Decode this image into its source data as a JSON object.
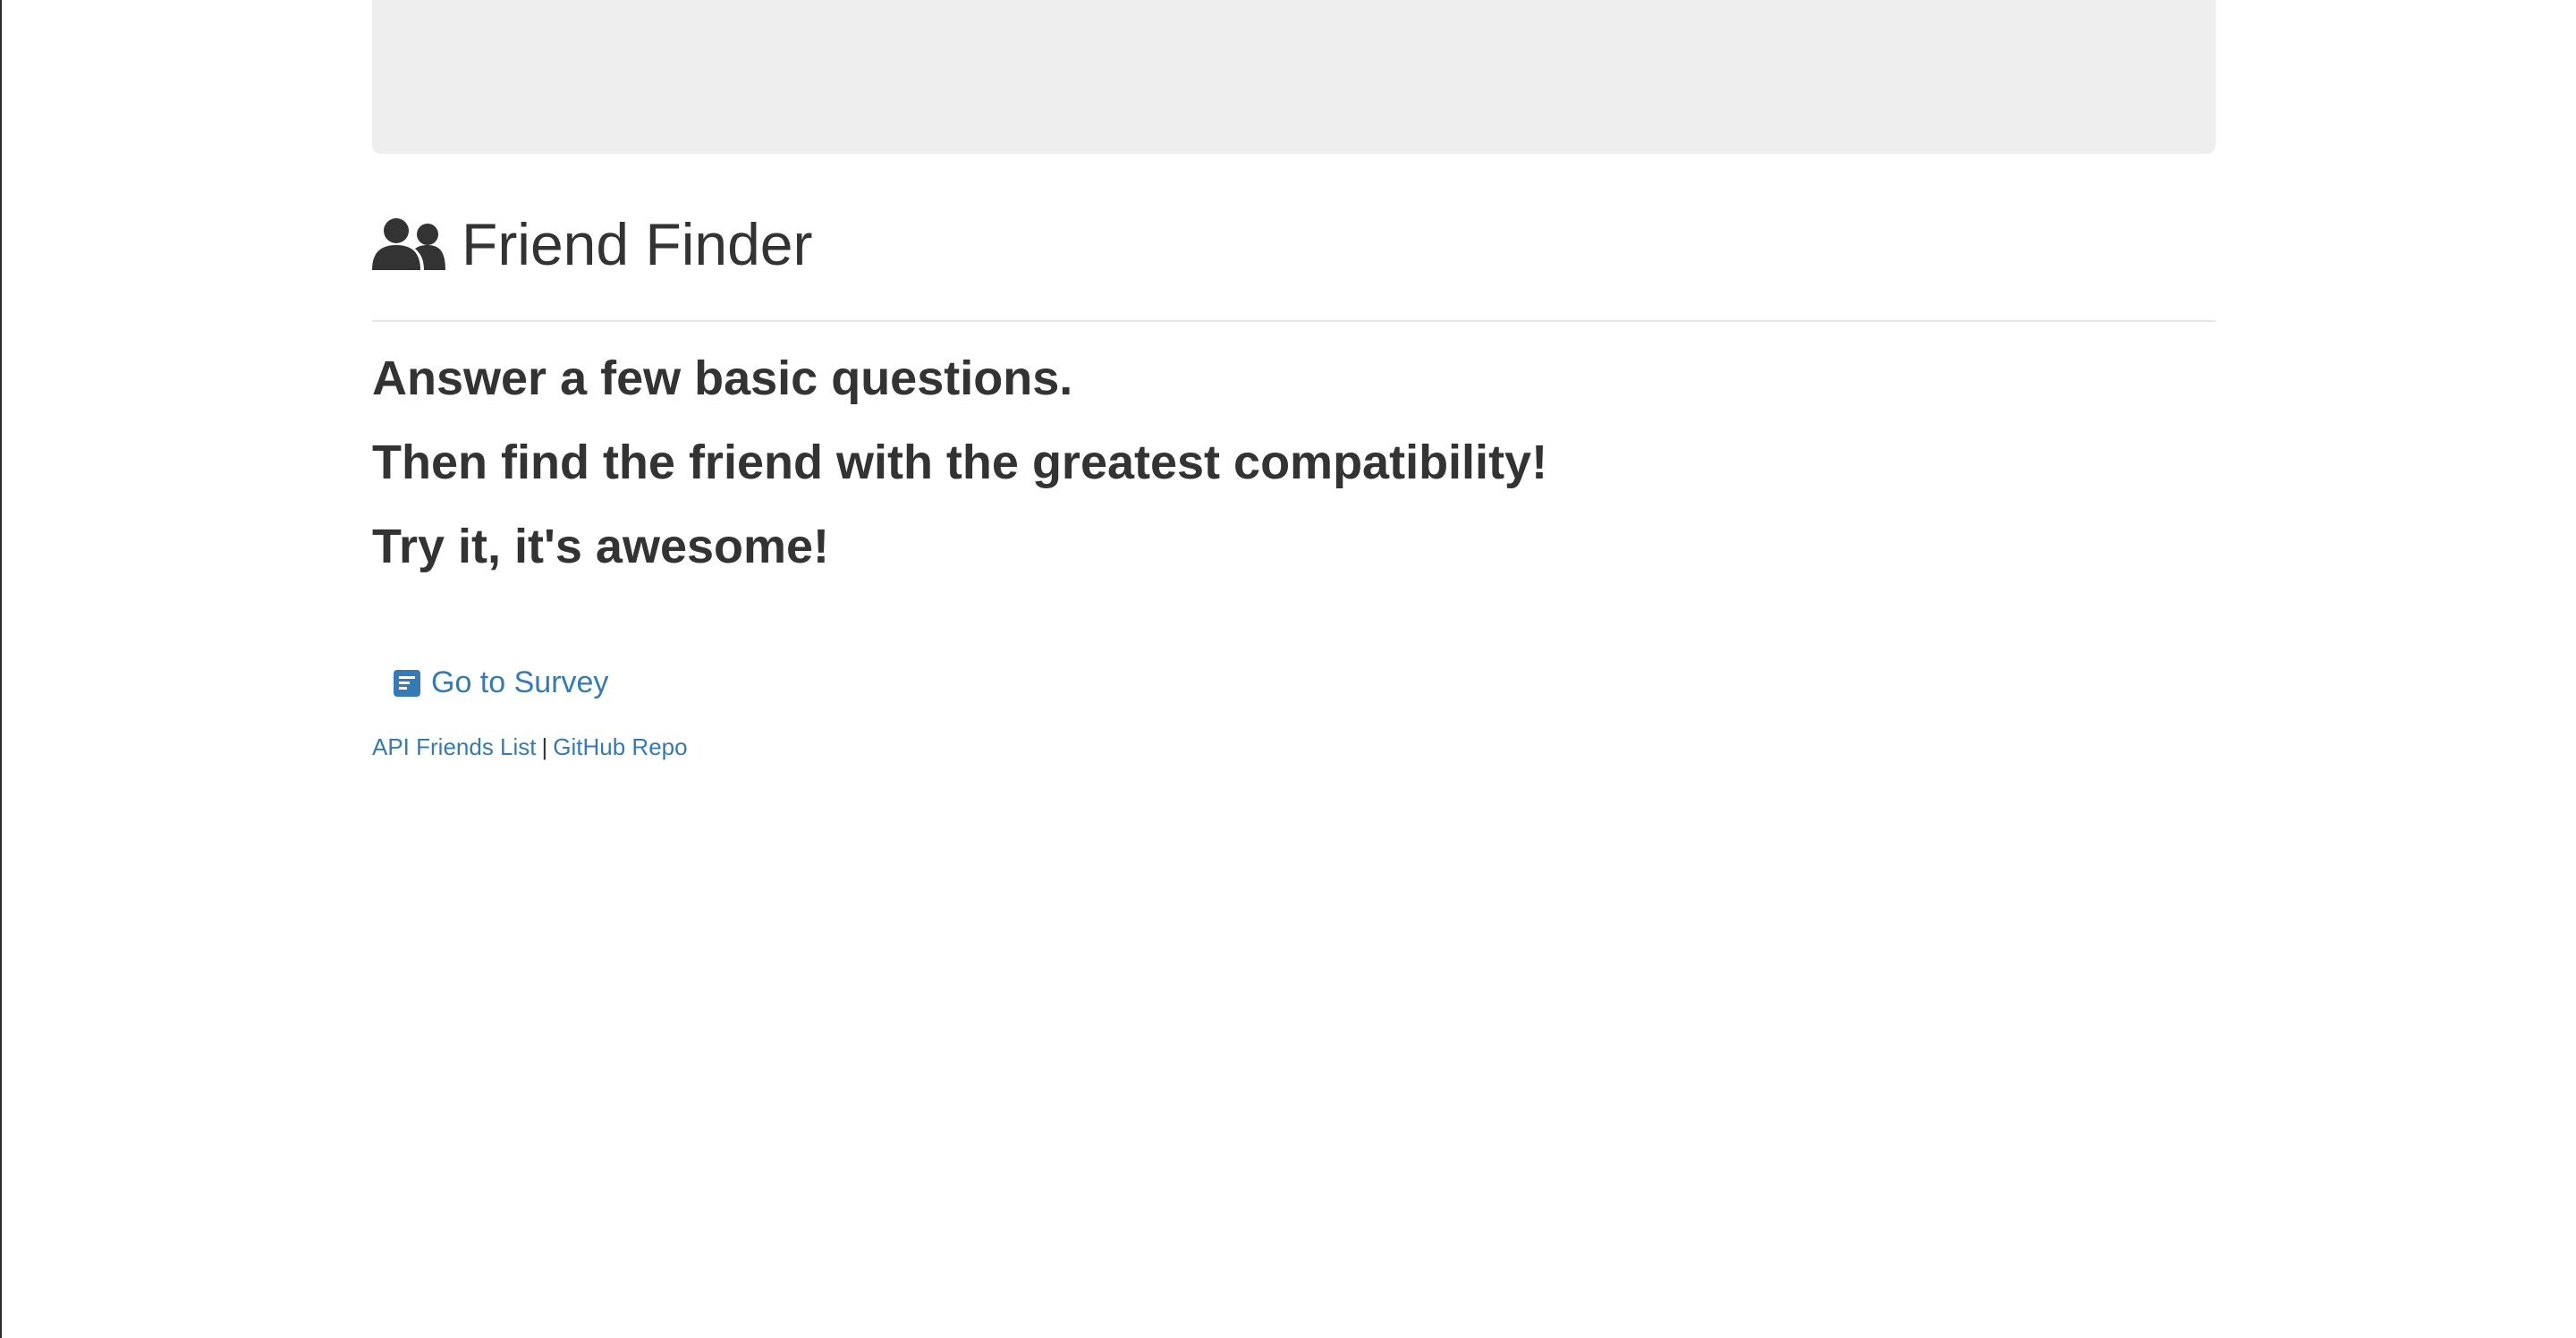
{
  "header": {
    "title": "Friend Finder",
    "icon": "users-icon"
  },
  "intro": {
    "lines": [
      "Answer a few basic questions.",
      "Then find the friend with the greatest compatibility!",
      "Try it, it's awesome!"
    ]
  },
  "actions": {
    "survey_label": "Go to Survey",
    "survey_icon": "survey-icon"
  },
  "footer": {
    "api_link": "API Friends List",
    "separator": "|",
    "github_link": "GitHub Repo"
  },
  "colors": {
    "link": "#337ab7",
    "text": "#333333",
    "jumbotron": "#eeeeee"
  }
}
